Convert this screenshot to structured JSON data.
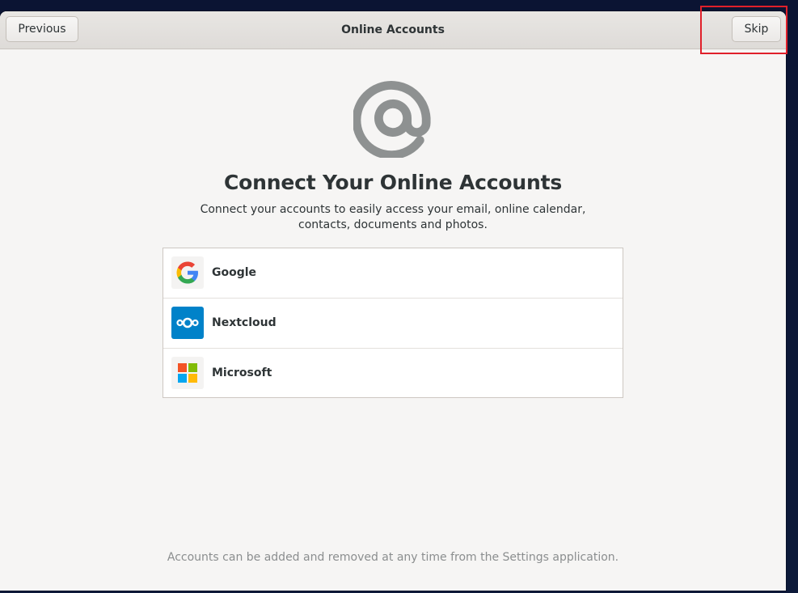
{
  "window": {
    "title": "Online Accounts"
  },
  "header": {
    "previous_label": "Previous",
    "skip_label": "Skip"
  },
  "main": {
    "heading": "Connect Your Online Accounts",
    "description": "Connect your accounts to easily access your email, online calendar, contacts, documents and photos.",
    "providers": [
      {
        "label": "Google",
        "icon": "google-icon"
      },
      {
        "label": "Nextcloud",
        "icon": "nextcloud-icon"
      },
      {
        "label": "Microsoft",
        "icon": "microsoft-icon"
      }
    ],
    "footer_note": "Accounts can be added and removed at any time from the Settings application."
  },
  "colors": {
    "highlight": "#e0202a",
    "nextcloud_blue": "#0082c9",
    "at_icon_gray": "#8e9191"
  }
}
